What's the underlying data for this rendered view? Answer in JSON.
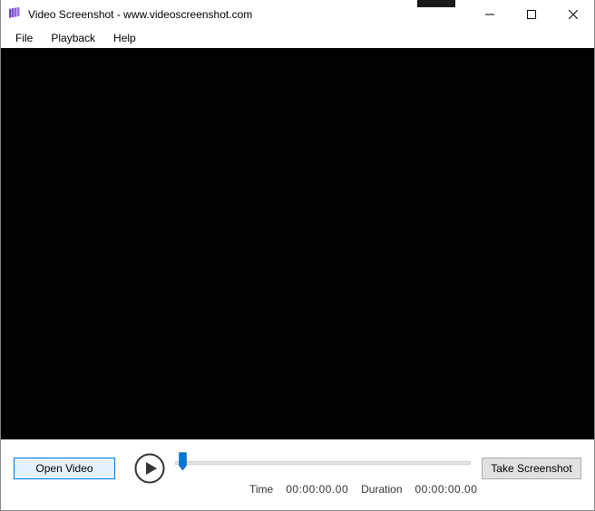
{
  "titlebar": {
    "title": "Video Screenshot - www.videoscreenshot.com"
  },
  "menubar": {
    "items": [
      "File",
      "Playback",
      "Help"
    ]
  },
  "controls": {
    "open_video_label": "Open Video",
    "take_screenshot_label": "Take Screenshot",
    "time_label": "Time",
    "time_value": "00:00:00.00",
    "duration_label": "Duration",
    "duration_value": "00:00:00.00"
  }
}
